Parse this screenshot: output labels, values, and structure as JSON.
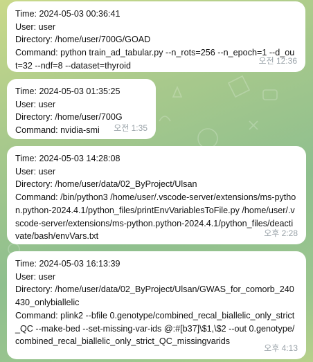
{
  "messages": [
    {
      "lines": [
        "Time: 2024-05-03 00:36:41",
        "User: user",
        "Directory: /home/user/700G/GOAD",
        "Command: python train_ad_tabular.py --n_rots=256 --n_epoch=1 --d_out=32 --ndf=8 --dataset=thyroid"
      ],
      "time": "오전 12:36"
    },
    {
      "lines": [
        "Time: 2024-05-03 01:35:25",
        "User: user",
        "Directory: /home/user/700G",
        "Command: nvidia-smi"
      ],
      "time": "오전 1:35"
    },
    {
      "lines": [
        "Time: 2024-05-03 14:28:08",
        "User: user",
        "Directory: /home/user/data/02_ByProject/Ulsan",
        "Command: /bin/python3 /home/user/.vscode-server/extensions/ms-python.python-2024.4.1/python_files/printEnvVariablesToFile.py /home/user/.vscode-server/extensions/ms-python.python-2024.4.1/python_files/deactivate/bash/envVars.txt"
      ],
      "time": "오후 2:28"
    },
    {
      "lines": [
        "Time: 2024-05-03 16:13:39",
        "User: user",
        "Directory: /home/user/data/02_ByProject/Ulsan/GWAS_for_comorb_240430_onlybiallelic",
        "Command: plink2 --bfile 0.genotype/combined_recal_biallelic_only_strict_QC --make-bed --set-missing-var-ids @:#[b37]\\$1,\\$2 --out 0.genotype/combined_recal_biallelic_only_strict_QC_missingvarids"
      ],
      "time": "오후 4:13"
    }
  ]
}
